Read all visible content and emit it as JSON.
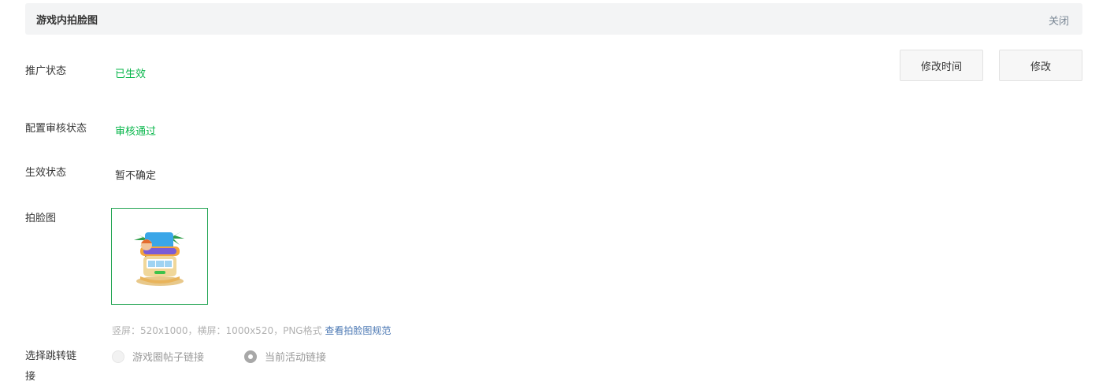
{
  "header": {
    "title": "游戏内拍脸图",
    "close_label": "关闭"
  },
  "buttons": {
    "modify_time": "修改时间",
    "modify": "修改"
  },
  "fields": {
    "promo_status": {
      "label": "推广状态",
      "value": "已生效"
    },
    "review_status": {
      "label": "配置审核状态",
      "value": "审核通过"
    },
    "effect_status": {
      "label": "生效状态",
      "value": "暂不确定"
    },
    "face_image": {
      "label": "拍脸图"
    }
  },
  "hint": {
    "text": "竖屏：520x1000，横屏：1000x520，PNG格式 ",
    "link": "查看拍脸图规范"
  },
  "jump": {
    "label_line1": "选择跳转链",
    "label_line2": "接",
    "options": [
      {
        "label": "游戏圈帖子链接",
        "selected": false
      },
      {
        "label": "当前活动链接",
        "selected": true
      }
    ]
  },
  "colors": {
    "accent_green": "#07b64a",
    "link_blue": "#4a77b3",
    "header_bg": "#f3f4f5"
  }
}
